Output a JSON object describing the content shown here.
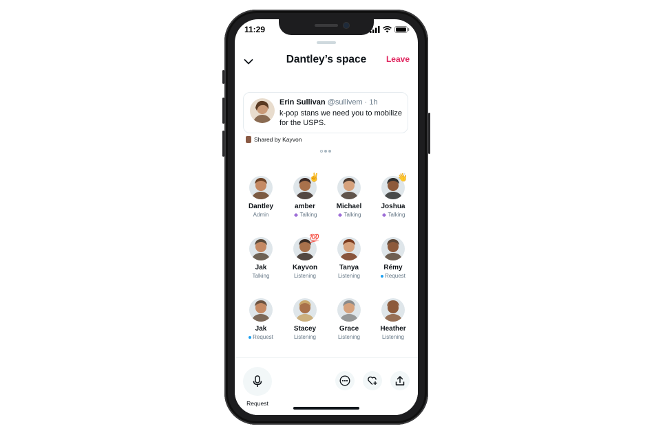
{
  "status_bar": {
    "time": "11:29"
  },
  "header": {
    "title": "Dantley’s space",
    "leave_label": "Leave"
  },
  "tweet": {
    "name": "Erin Sullivan",
    "meta": "@sullivem · 1h",
    "text": "k-pop stans we need you to mobilize for the USPS."
  },
  "shared_by": "Shared by Kayvon",
  "participants": [
    {
      "name": "Dantley",
      "status": "Admin",
      "kind": "plain",
      "color": "#6b4226"
    },
    {
      "name": "amber",
      "status": "Talking",
      "kind": "talking",
      "color": "#3b2a25",
      "emoji": "✌️"
    },
    {
      "name": "Michael",
      "status": "Talking",
      "kind": "talking",
      "color": "#4a3a30"
    },
    {
      "name": "Joshua",
      "status": "Talking",
      "kind": "talking",
      "color": "#2f2f2f",
      "emoji": "👋"
    },
    {
      "name": "Jak",
      "status": "Talking",
      "kind": "plain",
      "color": "#5a4a3a"
    },
    {
      "name": "Kayvon",
      "status": "Listening",
      "kind": "plain",
      "color": "#3a2c24",
      "emoji": "💯"
    },
    {
      "name": "Tanya",
      "status": "Listening",
      "kind": "plain",
      "color": "#7a3b1e"
    },
    {
      "name": "Rémy",
      "status": "Request",
      "kind": "request",
      "color": "#5c4636"
    },
    {
      "name": "Jak",
      "status": "Request",
      "kind": "request",
      "color": "#6b5240"
    },
    {
      "name": "Stacey",
      "status": "Listening",
      "kind": "plain",
      "color": "#c9a66b"
    },
    {
      "name": "Grace",
      "status": "Listening",
      "kind": "plain",
      "color": "#8a8a8a"
    },
    {
      "name": "Heather",
      "status": "Listening",
      "kind": "plain",
      "color": "#8b5a3c"
    }
  ],
  "toolbar": {
    "mic_label": "Request"
  },
  "colors": {
    "accent_pink": "#e0245e",
    "talking_purple": "#9b6bd6",
    "request_blue": "#1da1f2"
  }
}
